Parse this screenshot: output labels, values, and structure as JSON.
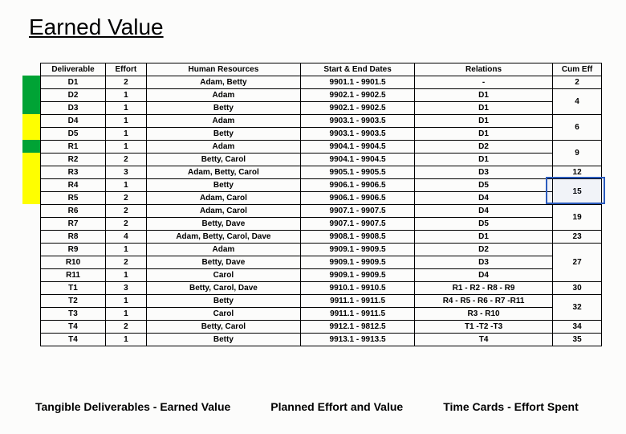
{
  "title": "Earned Value",
  "headers": {
    "deliverable": "Deliverable",
    "effort": "Effort",
    "hr": "Human Resources",
    "dates": "Start & End Dates",
    "relations": "Relations",
    "cumeff": "Cum Eff"
  },
  "rows": [
    {
      "d": "D1",
      "e": "2",
      "hr": "Adam, Betty",
      "dates": "9901.1 - 9901.5",
      "rel": "-",
      "cum": "2",
      "cumSpan": 1,
      "hl": "green"
    },
    {
      "d": "D2",
      "e": "1",
      "hr": "Adam",
      "dates": "9902.1 - 9902.5",
      "rel": "D1",
      "cum": "4",
      "cumSpan": 2,
      "hl": "green"
    },
    {
      "d": "D3",
      "e": "1",
      "hr": "Betty",
      "dates": "9902.1 - 9902.5",
      "rel": "D1",
      "cum": null,
      "cumSpan": 0,
      "hl": "green"
    },
    {
      "d": "D4",
      "e": "1",
      "hr": "Adam",
      "dates": "9903.1 - 9903.5",
      "rel": "D1",
      "cum": "6",
      "cumSpan": 2,
      "hl": "yellow"
    },
    {
      "d": "D5",
      "e": "1",
      "hr": "Betty",
      "dates": "9903.1 - 9903.5",
      "rel": "D1",
      "cum": null,
      "cumSpan": 0,
      "hl": "yellow"
    },
    {
      "d": "R1",
      "e": "1",
      "hr": "Adam",
      "dates": "9904.1 - 9904.5",
      "rel": "D2",
      "cum": "9",
      "cumSpan": 2,
      "hl": "green"
    },
    {
      "d": "R2",
      "e": "2",
      "hr": "Betty, Carol",
      "dates": "9904.1 - 9904.5",
      "rel": "D1",
      "cum": null,
      "cumSpan": 0,
      "hl": "yellow"
    },
    {
      "d": "R3",
      "e": "3",
      "hr": "Adam, Betty, Carol",
      "dates": "9905.1 - 9905.5",
      "rel": "D3",
      "cum": "12",
      "cumSpan": 1,
      "hl": "yellow"
    },
    {
      "d": "R4",
      "e": "1",
      "hr": "Betty",
      "dates": "9906.1 - 9906.5",
      "rel": "D5",
      "cum": "15",
      "cumSpan": 2,
      "hl": "yellow"
    },
    {
      "d": "R5",
      "e": "2",
      "hr": "Adam, Carol",
      "dates": "9906.1 - 9906.5",
      "rel": "D4",
      "cum": null,
      "cumSpan": 0,
      "hl": "yellow"
    },
    {
      "d": "R6",
      "e": "2",
      "hr": "Adam, Carol",
      "dates": "9907.1 - 9907.5",
      "rel": "D4",
      "cum": "19",
      "cumSpan": 2,
      "hl": null
    },
    {
      "d": "R7",
      "e": "2",
      "hr": "Betty, Dave",
      "dates": "9907.1 - 9907.5",
      "rel": "D5",
      "cum": null,
      "cumSpan": 0,
      "hl": null
    },
    {
      "d": "R8",
      "e": "4",
      "hr": "Adam, Betty, Carol, Dave",
      "dates": "9908.1 - 9908.5",
      "rel": "D1",
      "cum": "23",
      "cumSpan": 1,
      "hl": null
    },
    {
      "d": "R9",
      "e": "1",
      "hr": "Adam",
      "dates": "9909.1 - 9909.5",
      "rel": "D2",
      "cum": "27",
      "cumSpan": 3,
      "hl": null
    },
    {
      "d": "R10",
      "e": "2",
      "hr": "Betty, Dave",
      "dates": "9909.1 - 9909.5",
      "rel": "D3",
      "cum": null,
      "cumSpan": 0,
      "hl": null
    },
    {
      "d": "R11",
      "e": "1",
      "hr": "Carol",
      "dates": "9909.1 - 9909.5",
      "rel": "D4",
      "cum": null,
      "cumSpan": 0,
      "hl": null
    },
    {
      "d": "T1",
      "e": "3",
      "hr": "Betty, Carol, Dave",
      "dates": "9910.1 - 9910.5",
      "rel": "R1 - R2 - R8 - R9",
      "cum": "30",
      "cumSpan": 1,
      "hl": null
    },
    {
      "d": "T2",
      "e": "1",
      "hr": "Betty",
      "dates": "9911.1 - 9911.5",
      "rel": "R4 - R5 - R6 - R7 -R11",
      "cum": "32",
      "cumSpan": 2,
      "hl": null
    },
    {
      "d": "T3",
      "e": "1",
      "hr": "Carol",
      "dates": "9911.1 - 9911.5",
      "rel": "R3 - R10",
      "cum": null,
      "cumSpan": 0,
      "hl": null
    },
    {
      "d": "T4",
      "e": "2",
      "hr": "Betty, Carol",
      "dates": "9912.1 - 9812.5",
      "rel": "T1 -T2 -T3",
      "cum": "34",
      "cumSpan": 1,
      "hl": null
    },
    {
      "d": "T4",
      "e": "1",
      "hr": "Betty",
      "dates": "9913.1 - 9913.5",
      "rel": "T4",
      "cum": "35",
      "cumSpan": 1,
      "hl": null
    }
  ],
  "cumHighlightIndex": 8,
  "footer": {
    "left": "Tangible Deliverables - Earned Value",
    "mid": "Planned Effort and Value",
    "right": "Time Cards - Effort Spent"
  },
  "columnWidths": {
    "d": 80,
    "e": 50,
    "hr": 190,
    "dates": 140,
    "rel": 170,
    "cum": 60
  }
}
